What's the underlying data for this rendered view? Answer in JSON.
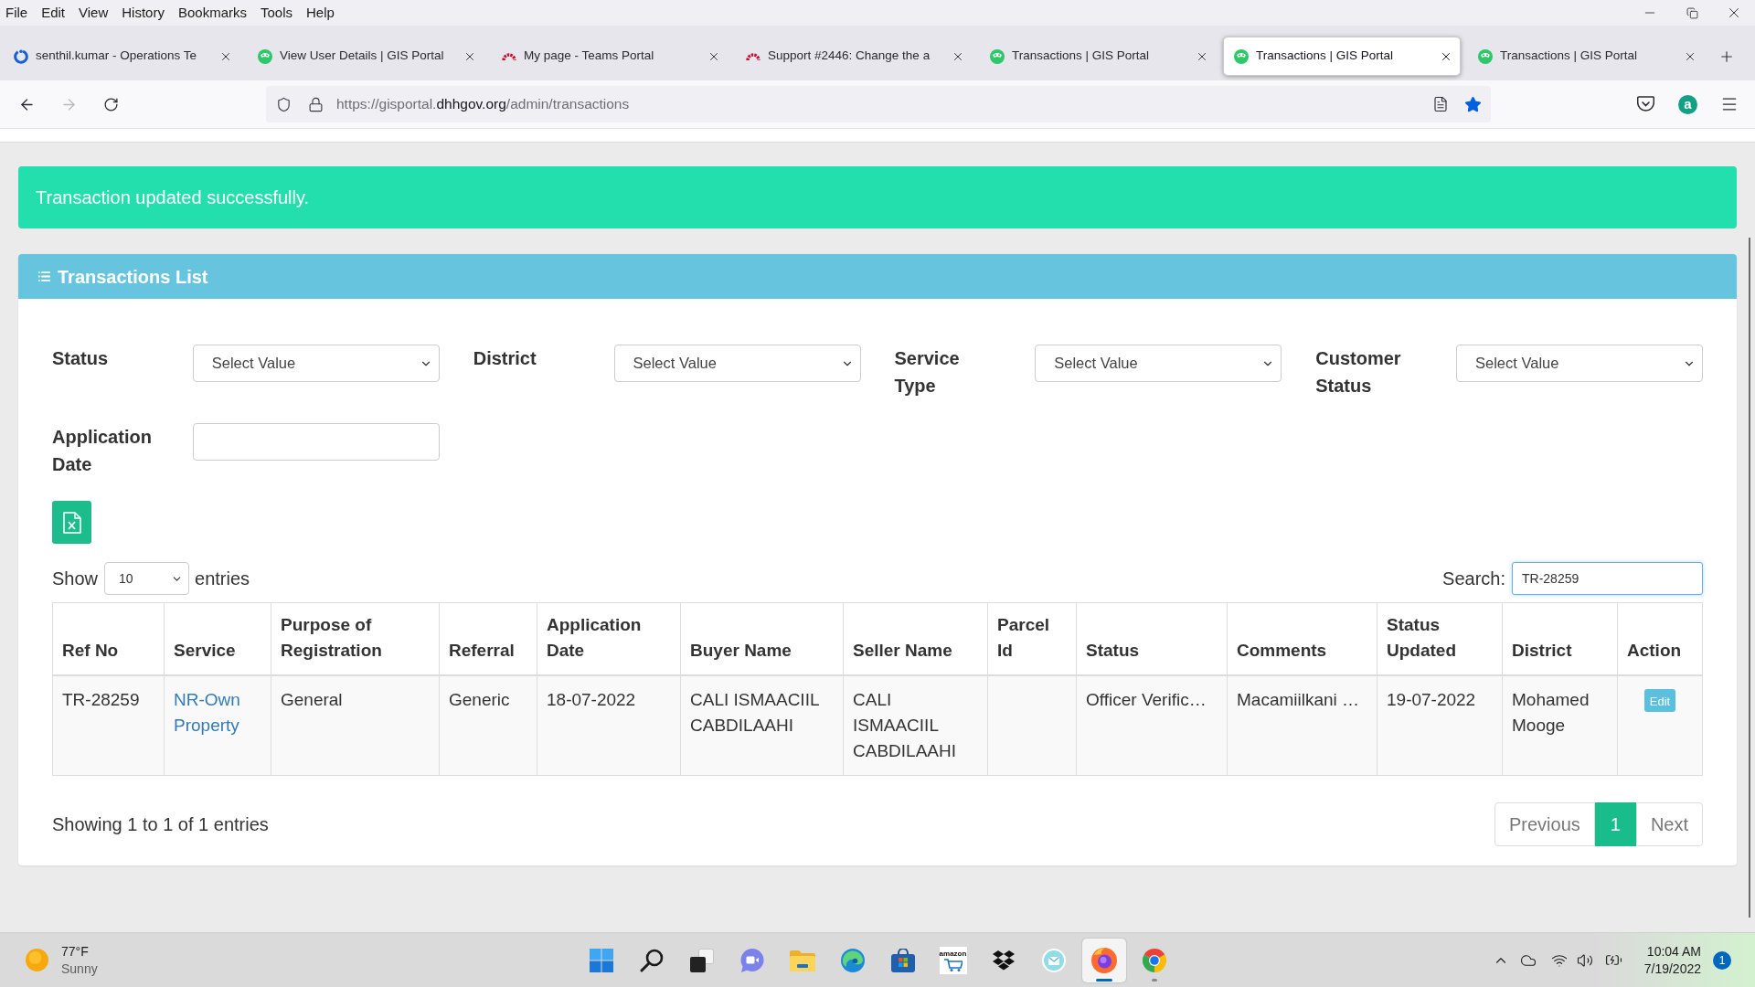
{
  "menu_bar": {
    "items": [
      "File",
      "Edit",
      "View",
      "History",
      "Bookmarks",
      "Tools",
      "Help"
    ]
  },
  "tabs": [
    {
      "title": "senthil.kumar - Operations Te",
      "kind": "ring",
      "selected": false
    },
    {
      "title": "View User Details | GIS Portal",
      "kind": "portal",
      "selected": false
    },
    {
      "title": "My page - Teams Portal",
      "kind": "arch",
      "selected": false
    },
    {
      "title": "Support #2446: Change the a",
      "kind": "arch",
      "selected": false
    },
    {
      "title": "Transactions | GIS Portal",
      "kind": "portal",
      "selected": false
    },
    {
      "title": "Transactions | GIS Portal",
      "kind": "portal",
      "selected": true
    },
    {
      "title": "Transactions | GIS Portal",
      "kind": "portal",
      "selected": false
    }
  ],
  "toolbar": {
    "back_disabled": false,
    "forward_disabled": true,
    "url": {
      "host_prefix": "https://gisportal.",
      "domain": "dhhgov.org",
      "path": "/admin/transactions"
    },
    "bookmarked": true,
    "extension_label": "a"
  },
  "alert": {
    "message": "Transaction updated successfully."
  },
  "panel": {
    "title": "Transactions List",
    "filters": [
      {
        "label": "Status",
        "kind": "select",
        "value": "Select Value"
      },
      {
        "label": "District",
        "kind": "select",
        "value": "Select Value"
      },
      {
        "label": "Service Type",
        "kind": "select",
        "value": "Select Value"
      },
      {
        "label": "Customer Status",
        "kind": "select",
        "value": "Select Value"
      },
      {
        "label": "Application Date",
        "kind": "date"
      }
    ],
    "page_length": {
      "prefix": "Show",
      "value": "10",
      "suffix": "entries"
    },
    "search": {
      "label": "Search:",
      "value": "TR-28259"
    },
    "table": {
      "columns": [
        "Ref No",
        "Service",
        "Purpose of Registration",
        "Referral",
        "Application Date",
        "Buyer Name",
        "Seller Name",
        "Parcel Id",
        "Status",
        "Comments",
        "Status Updated",
        "District",
        "Action"
      ],
      "rows": [
        {
          "cells": [
            {
              "kind": "text",
              "text": "TR-28259"
            },
            {
              "kind": "link",
              "text": "NR-Own Property"
            },
            {
              "kind": "text",
              "text": "General"
            },
            {
              "kind": "text",
              "text": "Generic"
            },
            {
              "kind": "text",
              "text": "18-07-2022"
            },
            {
              "kind": "text",
              "text": "CALI ISMAACIIL CABDILAAHI"
            },
            {
              "kind": "text",
              "text": "CALI ISMAACIIL CABDILAAHI"
            },
            {
              "kind": "empty"
            },
            {
              "kind": "text",
              "text": "Officer Verific…"
            },
            {
              "kind": "text",
              "text": "Macamiilkani …"
            },
            {
              "kind": "text",
              "text": "19-07-2022"
            },
            {
              "kind": "text",
              "text": "Mohamed Mooge"
            },
            {
              "kind": "button",
              "text": "Edit"
            }
          ]
        }
      ]
    },
    "info": "Showing 1 to 1 of 1 entries",
    "pagination": {
      "previous": {
        "label": "Previous",
        "disabled": true
      },
      "pages": [
        {
          "label": "1",
          "selected": true
        }
      ],
      "next": {
        "label": "Next",
        "disabled": true
      }
    }
  },
  "taskbar": {
    "weather": {
      "temperature": "77°F",
      "condition": "Sunny"
    },
    "apps": [
      {
        "kind": "start",
        "active": false,
        "running": false
      },
      {
        "kind": "search",
        "active": false,
        "running": false
      },
      {
        "kind": "taskview",
        "active": false,
        "running": false
      },
      {
        "kind": "chat",
        "active": false,
        "running": false
      },
      {
        "kind": "explorer",
        "active": false,
        "running": false
      },
      {
        "kind": "edge",
        "active": false,
        "running": false
      },
      {
        "kind": "store",
        "active": false,
        "running": false
      },
      {
        "kind": "amazon",
        "text": "amazon",
        "active": false,
        "running": false
      },
      {
        "kind": "dropbox",
        "active": false,
        "running": false
      },
      {
        "kind": "mail",
        "active": false,
        "running": false
      },
      {
        "kind": "firefox",
        "active": true,
        "running": true
      },
      {
        "kind": "chrome",
        "active": false,
        "running": true
      }
    ],
    "clock": {
      "time": "10:04 AM",
      "date": "7/19/2022"
    },
    "notifications": "1"
  }
}
